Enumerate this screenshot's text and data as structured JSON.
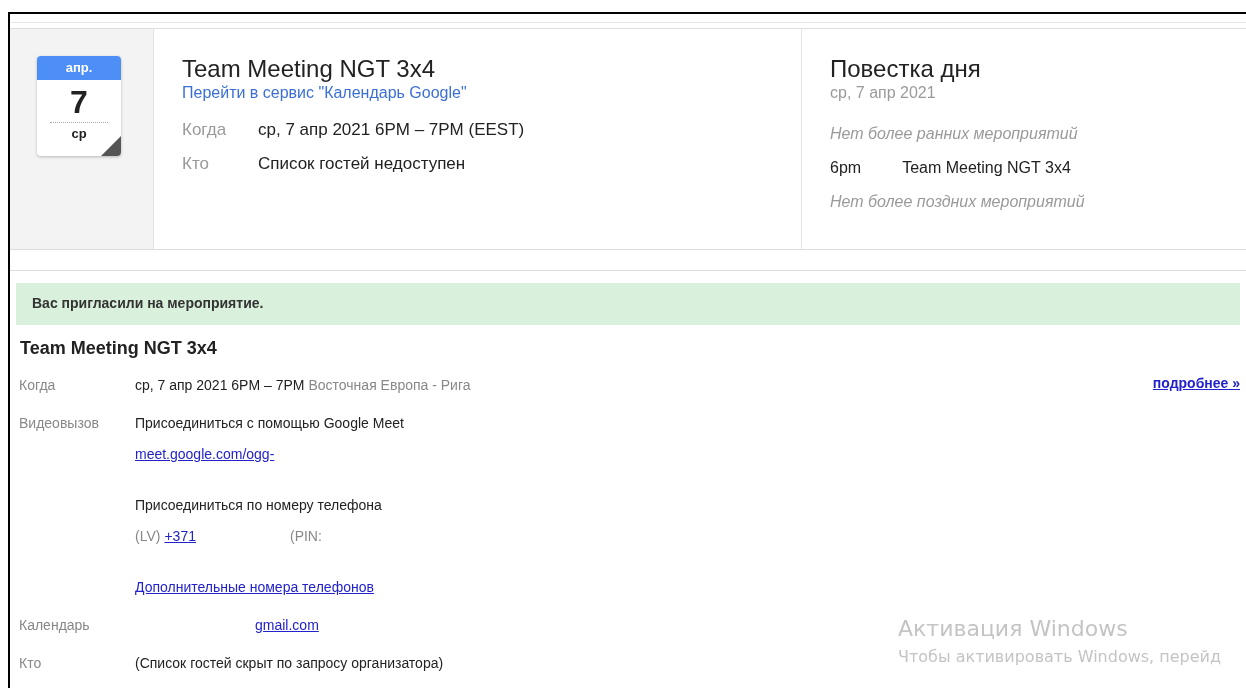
{
  "event_card": {
    "date_icon": {
      "month": "апр.",
      "day": "7",
      "weekday": "ср"
    },
    "title": "Team Meeting NGT 3x4",
    "calendar_link": "Перейти в сервис \"Календарь Google\"",
    "details": [
      {
        "label": "Когда",
        "value": "ср, 7 апр 2021 6PM – 7PM (EEST)"
      },
      {
        "label": "Кто",
        "value": "Список гостей недоступен"
      }
    ]
  },
  "agenda": {
    "title": "Повестка дня",
    "date": "ср, 7 апр 2021",
    "items": [
      {
        "kind": "note",
        "text": "Нет более ранних мероприятий"
      },
      {
        "kind": "event",
        "time": "6pm",
        "text": "Team Meeting NGT 3x4"
      },
      {
        "kind": "note",
        "text": "Нет более поздних мероприятий"
      }
    ]
  },
  "invite_banner": "Вас пригласили на мероприятие.",
  "invite": {
    "title": "Team Meeting NGT 3x4",
    "more_link": "подробнее »",
    "rows": [
      {
        "kind": "when",
        "label": "Когда",
        "blocks": [
          [
            [
              {
                "kind": "text",
                "text": "ср, 7 апр 2021 6PM – 7PM"
              },
              {
                "kind": "muted",
                "text": "Восточная Европа - Рига"
              }
            ]
          ]
        ]
      },
      {
        "kind": "video",
        "label": "Видеовызов",
        "blocks": [
          [
            [
              {
                "kind": "text",
                "text": "Присоединиться с помощью Google Meet"
              }
            ],
            [
              {
                "kind": "link",
                "text": "meet.google.com/ogg-"
              }
            ]
          ],
          [
            [
              {
                "kind": "text",
                "text": "Присоединиться по номеру телефона"
              }
            ],
            [
              {
                "kind": "muted",
                "text": "(LV)"
              },
              {
                "kind": "link",
                "text": "+371"
              },
              {
                "kind": "muted",
                "text": "(PIN:"
              }
            ]
          ],
          [
            [
              {
                "kind": "link",
                "text": "Дополнительные номера телефонов"
              }
            ]
          ]
        ]
      },
      {
        "kind": "calendar",
        "label": "Календарь",
        "blocks": [
          [
            [
              {
                "kind": "link",
                "text": "gmail.com"
              }
            ]
          ]
        ]
      },
      {
        "kind": "who",
        "label": "Кто",
        "blocks": [
          [
            [
              {
                "kind": "text",
                "text": "(Список гостей скрыт по запросу организатора)"
              }
            ]
          ]
        ]
      }
    ]
  },
  "windows_activation": {
    "title": "Активация Windows",
    "lines": [
      "Чтобы активировать Windows, перейд"
    ]
  }
}
